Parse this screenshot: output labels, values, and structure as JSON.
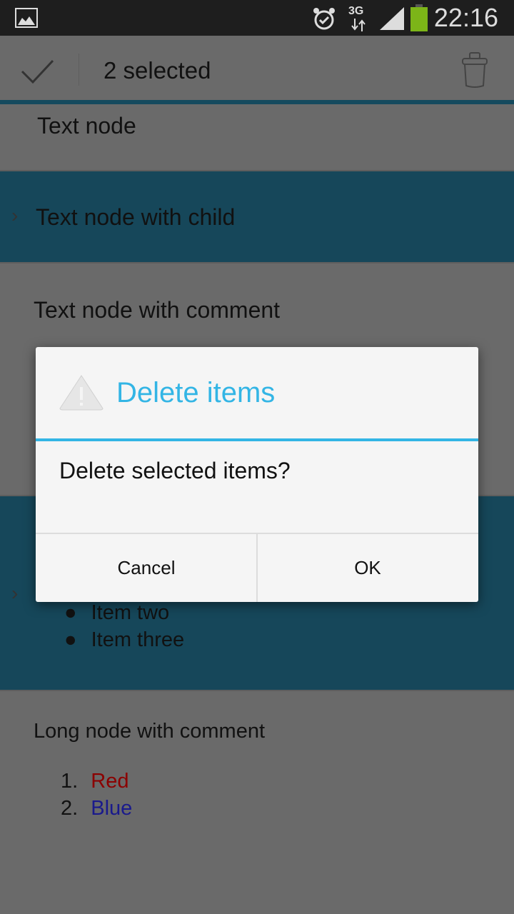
{
  "status_bar": {
    "time": "22:16",
    "network": "3G",
    "icons": [
      "gallery-icon",
      "alarm-icon",
      "data-3g-icon",
      "signal-icon",
      "battery-icon"
    ],
    "battery_color": "#7cb518"
  },
  "action_bar": {
    "title": "2 selected",
    "icons": [
      "check-icon",
      "trash-icon"
    ]
  },
  "list": {
    "items": [
      {
        "label": "Text node"
      },
      {
        "label": "Text node with child",
        "selected": true
      },
      {
        "label": "Text node with comment"
      },
      {
        "bullets": [
          "Item two",
          "Item three"
        ],
        "selected": true
      },
      {
        "label": "Long node with comment",
        "numbered": [
          {
            "n": "1.",
            "text": "Red",
            "color": "#8b0000"
          },
          {
            "n": "2.",
            "text": "Blue",
            "color": "#1a1a8c"
          }
        ]
      }
    ]
  },
  "dialog": {
    "icon": "warning-icon",
    "title": "Delete items",
    "message": "Delete selected items?",
    "cancel": "Cancel",
    "ok": "OK",
    "accent": "#33b5e5"
  }
}
